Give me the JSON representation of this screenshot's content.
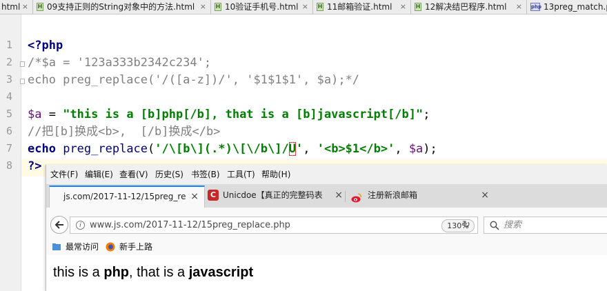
{
  "ide": {
    "tabs": [
      {
        "name": "html",
        "icon": "html-file-icon"
      },
      {
        "name": "09支持正则的String对象中的方法.html",
        "icon": "html-file-icon"
      },
      {
        "name": "10验证手机号.html",
        "icon": "html-file-icon"
      },
      {
        "name": "11邮箱验证.html",
        "icon": "html-file-icon"
      },
      {
        "name": "12解决结巴程序.html",
        "icon": "html-file-icon"
      },
      {
        "name": "13preg_match.p",
        "icon": "php-file-icon"
      }
    ],
    "tab_close_glyph": "×",
    "line_numbers": [
      "1",
      "2",
      "3",
      "4",
      "5",
      "6",
      "7",
      "8"
    ],
    "code": {
      "l1": "<?php",
      "l2": "/*$a = '123a333b2342c234';",
      "l3": "echo preg_replace('/([a-z])/', '$1$1$1', $a);*/",
      "l5_var": "$a",
      "l5_eq": " = ",
      "l5_str": "\"this is a [b]php[/b], that is a [b]javascript[/b]\"",
      "l5_end": ";",
      "l6": "//把[b]换成<b>,  [/b]换成</b>",
      "l7_kw": "echo",
      "l7_fn": "preg_replace",
      "l7_open": "(",
      "l7_pat1": "'/\\[b\\](.*)\\[\\/b\\]/",
      "l7_flag": "U",
      "l7_pat2": "'",
      "l7_comma1": ", ",
      "l7_rep": "'<b>$1</b>'",
      "l7_comma2": ", ",
      "l7_var": "$a",
      "l7_close": ");",
      "l8": "?>"
    }
  },
  "browser": {
    "menu": [
      "文件(F)",
      "编辑(E)",
      "查看(V)",
      "历史(S)",
      "书签(B)",
      "工具(T)",
      "帮助(H)"
    ],
    "tabs": [
      {
        "label": "js.com/2017-11-12/15preg_re",
        "active": true
      },
      {
        "label": "Unicdoe【真正的完整码表",
        "active": false
      },
      {
        "label": "注册新浪邮箱",
        "active": false
      }
    ],
    "tab_close_glyph": "×",
    "new_tab_glyph": "+",
    "url": "www.js.com/2017-11-12/15preg_replace.php",
    "zoom": "130%",
    "search_placeholder": "搜索",
    "bookmarks": [
      "最常访问",
      "新手上路"
    ],
    "page": {
      "t1": "this is a ",
      "b1": "php",
      "t2": ", that is a ",
      "b2": "javascript"
    }
  },
  "colors": {
    "keyword": "#000080",
    "string": "#008000",
    "comment": "#808080",
    "variable": "#660e7a",
    "accent_tab": "#0a84ff",
    "highlight_box": "#e53935"
  }
}
